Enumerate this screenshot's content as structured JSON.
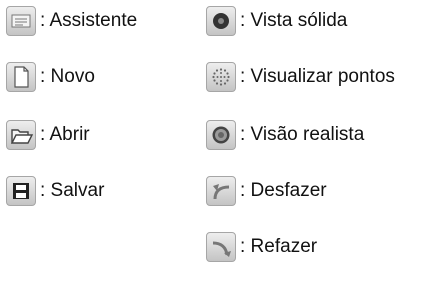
{
  "legend": {
    "left": [
      {
        "icon": "wizard-icon",
        "label": ": Assistente"
      },
      {
        "icon": "new-document-icon",
        "label": ": Novo"
      },
      {
        "icon": "open-folder-icon",
        "label": ": Abrir"
      },
      {
        "icon": "save-disk-icon",
        "label": ": Salvar"
      }
    ],
    "right": [
      {
        "icon": "solid-view-icon",
        "label": ": Vista sólida"
      },
      {
        "icon": "points-view-icon",
        "label": ": Visualizar pontos"
      },
      {
        "icon": "realistic-view-icon",
        "label": ": Visão realista"
      },
      {
        "icon": "undo-icon",
        "label": ": Desfazer"
      },
      {
        "icon": "redo-icon",
        "label": ": Refazer"
      }
    ]
  }
}
